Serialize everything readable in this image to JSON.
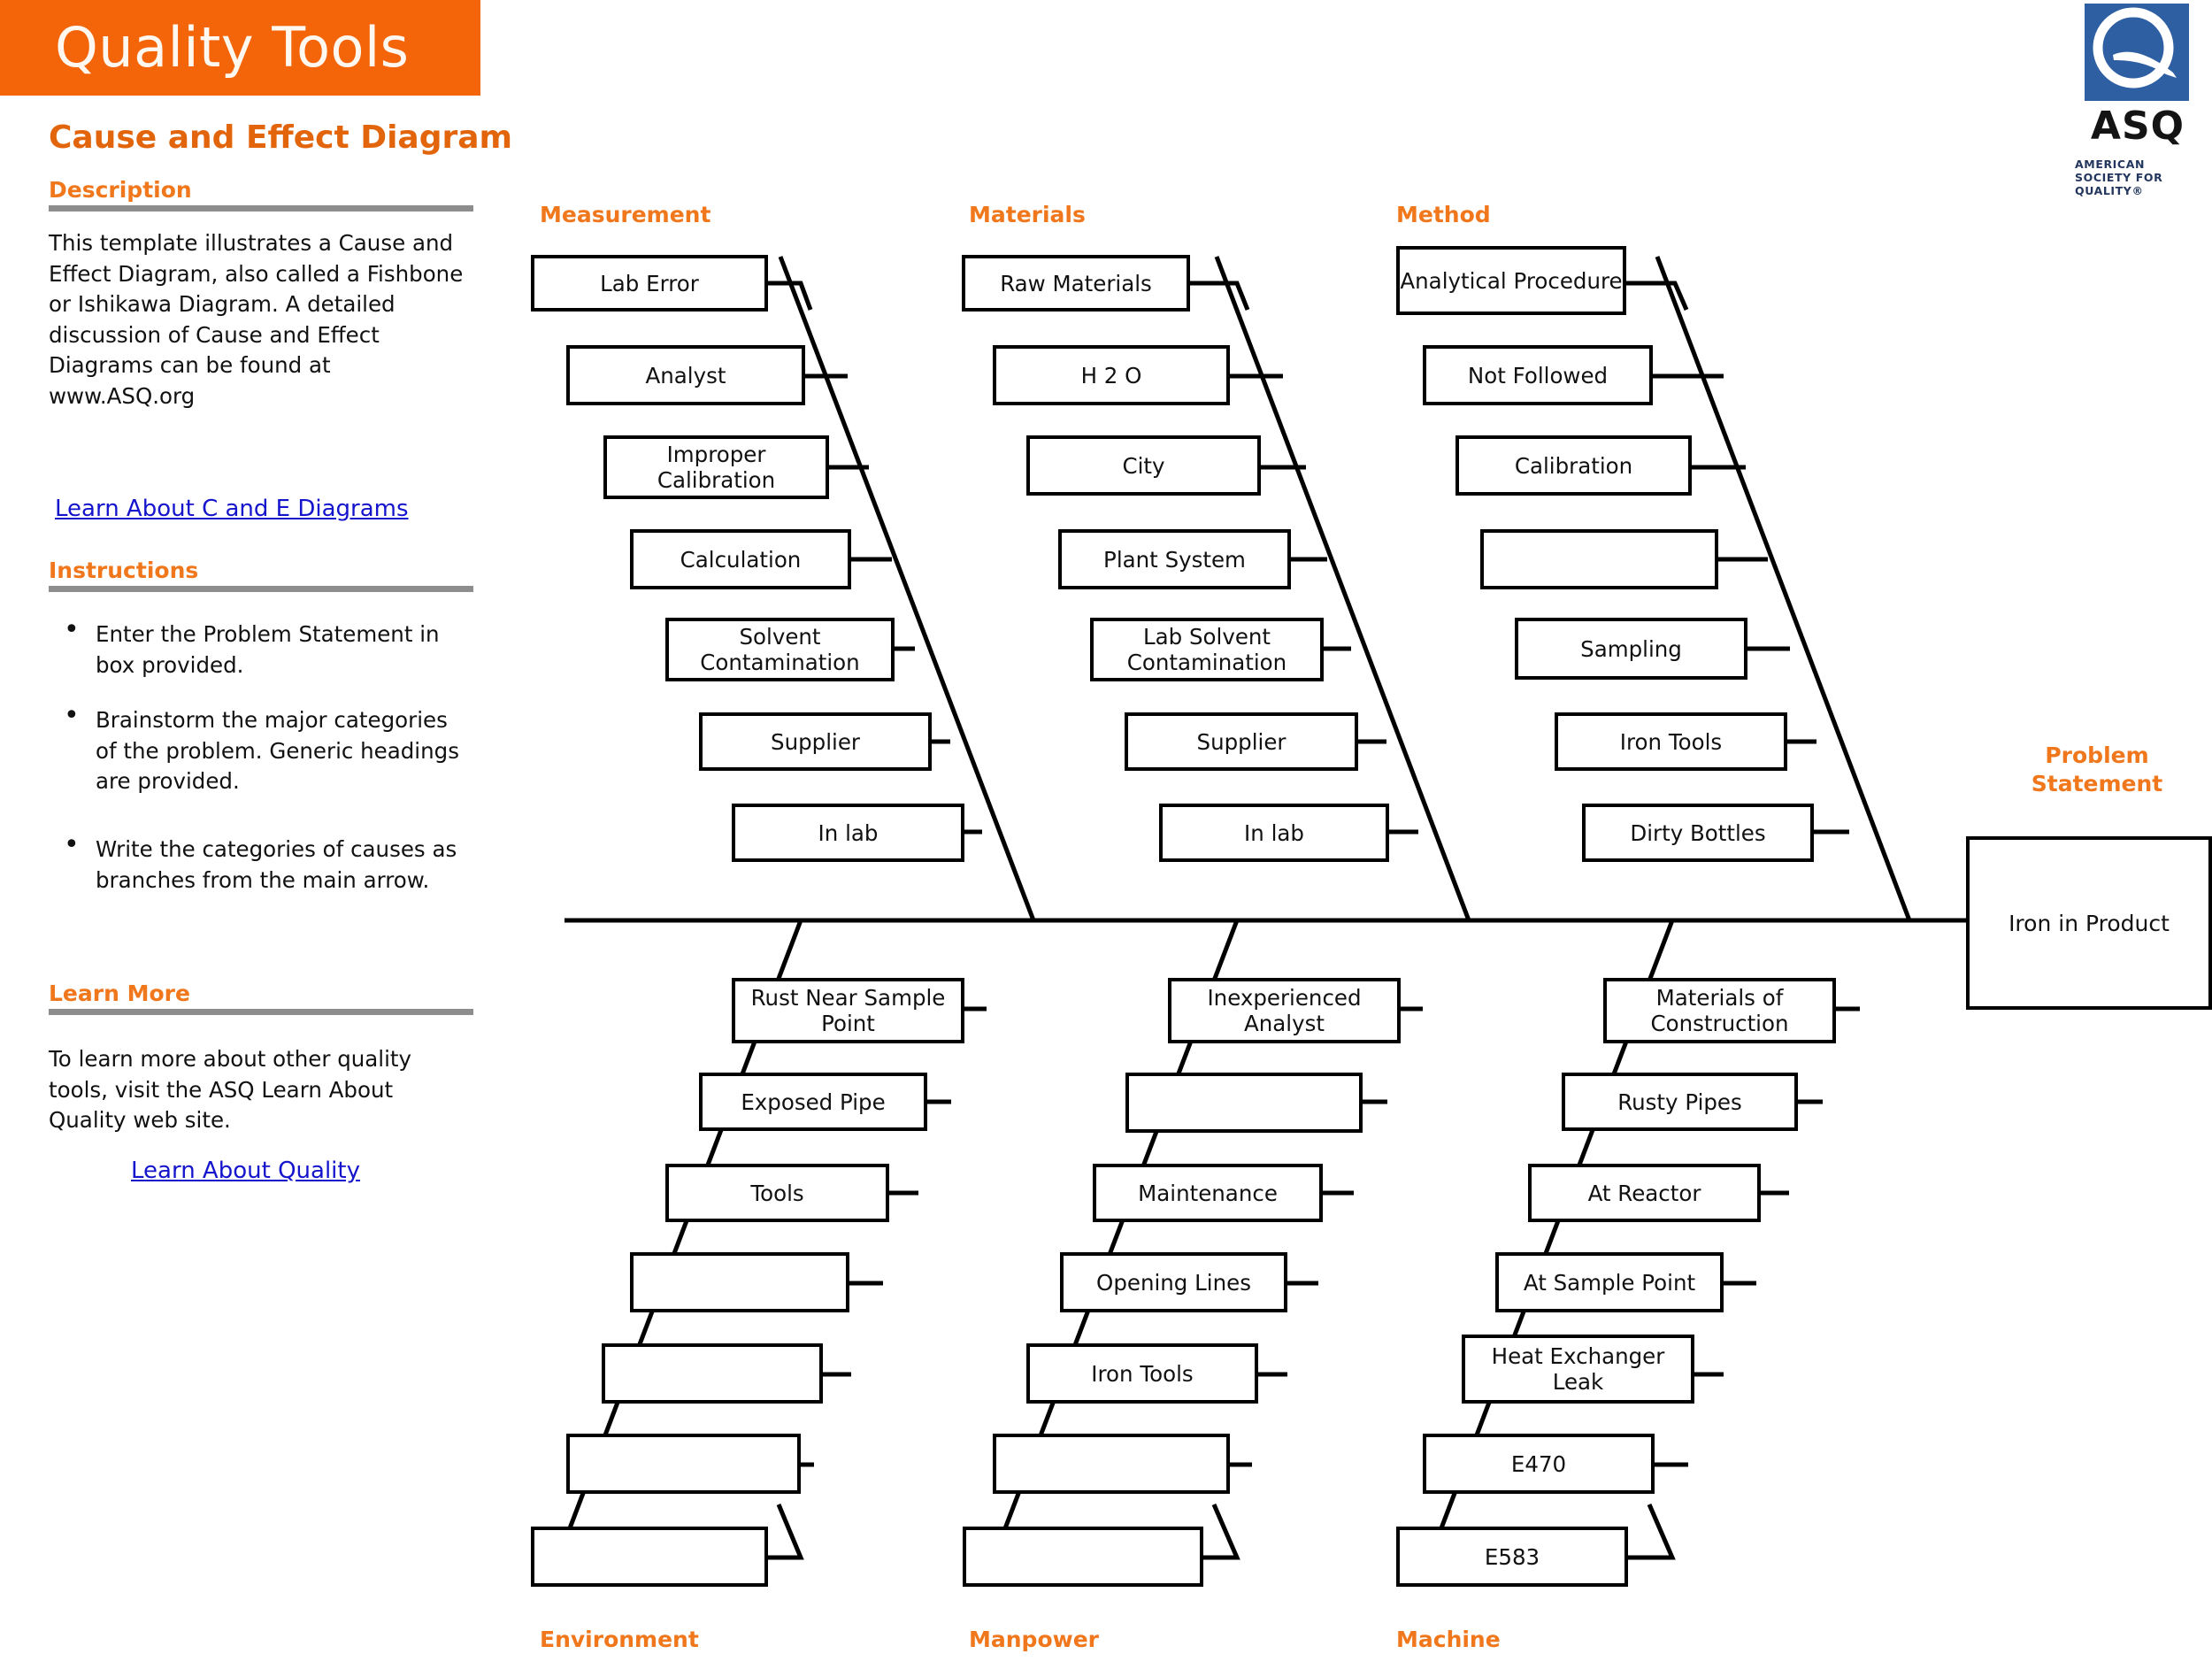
{
  "header": {
    "brand_title": "Quality Tools",
    "brand_bg": "#F4650A",
    "doc_title": "Cause and Effect Diagram",
    "accent_color": "#E2650C"
  },
  "logo": {
    "name": "asq-logo",
    "wordmark": "ASQ",
    "tagline": "AMERICAN SOCIETY FOR QUALITY®",
    "square_color": "#2E5FA3"
  },
  "sidebar": {
    "description": {
      "heading": "Description",
      "body": "This template illustrates a Cause and Effect Diagram, also called a Fishbone or Ishikawa Diagram.  A detailed discussion of Cause and Effect Diagrams can be found at www.ASQ.org",
      "link": "Learn About C and E Diagrams"
    },
    "instructions": {
      "heading": "Instructions",
      "items": [
        "Enter the Problem Statement in box provided.",
        "Brainstorm the major categories of the problem. Generic headings are provided.",
        "Write the categories of causes as branches from the main arrow."
      ]
    },
    "learn_more": {
      "heading": "Learn More",
      "body": "To learn more about other quality tools, visit the ASQ Learn About Quality web site.",
      "link": "Learn About Quality"
    }
  },
  "diagram": {
    "problem_label": "Problem Statement",
    "problem_statement": "Iron in Product",
    "categories": [
      {
        "name": "Measurement",
        "position": "top",
        "causes": [
          "Lab Error",
          "Analyst",
          "Improper Calibration",
          "Calculation",
          "Solvent Contamination",
          "Supplier",
          "In lab"
        ]
      },
      {
        "name": "Materials",
        "position": "top",
        "causes": [
          "Raw Materials",
          "H 2 O",
          "City",
          "Plant System",
          "Lab Solvent Contamination",
          "Supplier",
          "In lab"
        ]
      },
      {
        "name": "Method",
        "position": "top",
        "causes": [
          "Analytical Procedure",
          "Not Followed",
          "Calibration",
          "",
          "Sampling",
          "Iron Tools",
          "Dirty Bottles"
        ]
      },
      {
        "name": "Environment",
        "position": "bottom",
        "causes": [
          "Rust Near Sample Point",
          "Exposed Pipe",
          "Tools",
          "",
          "",
          "",
          ""
        ]
      },
      {
        "name": "Manpower",
        "position": "bottom",
        "causes": [
          "Inexperienced Analyst",
          "",
          "Maintenance",
          "Opening Lines",
          "Iron Tools",
          "",
          ""
        ]
      },
      {
        "name": "Machine",
        "position": "bottom",
        "causes": [
          "Materials of Construction",
          "Rusty Pipes",
          "At Reactor",
          "At Sample Point",
          "Heat Exchanger Leak",
          "E470",
          "E583"
        ]
      }
    ]
  }
}
